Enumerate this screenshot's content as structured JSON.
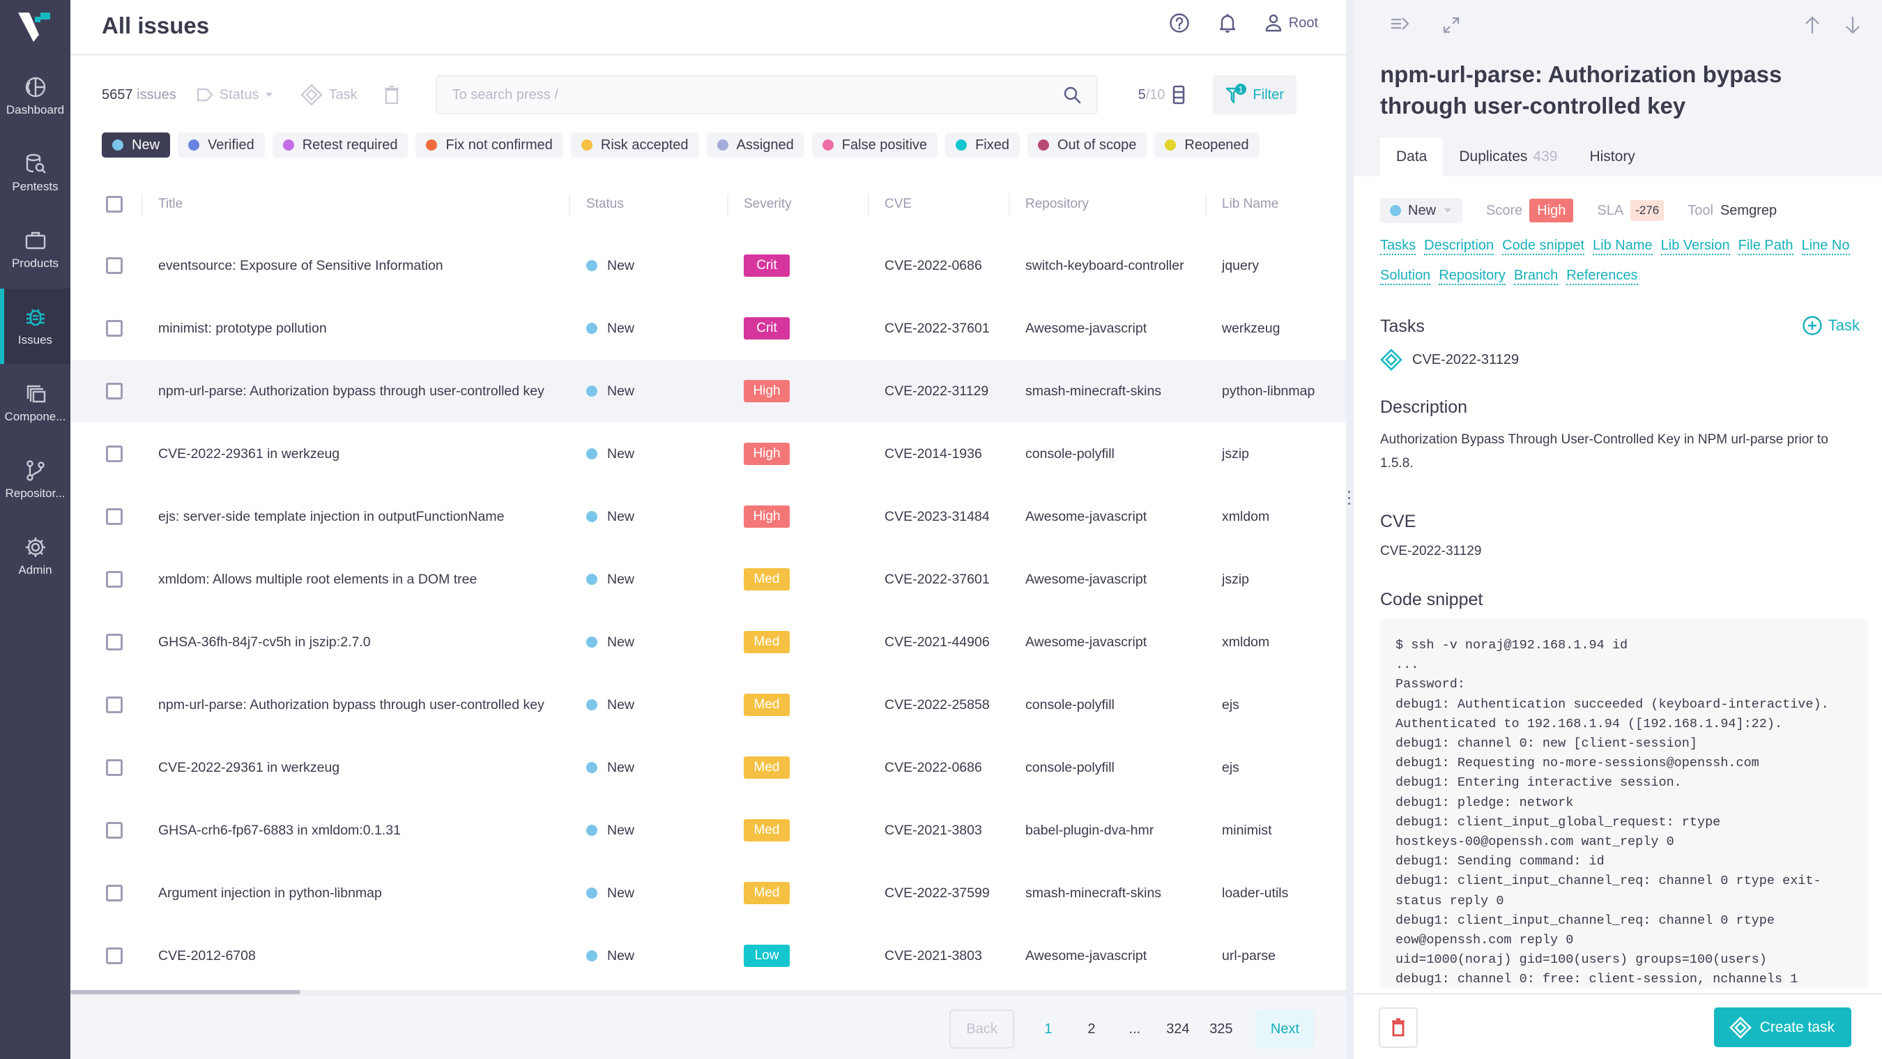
{
  "sidebar": {
    "items": [
      {
        "label": "Dashboard",
        "icon": "dashboard-icon"
      },
      {
        "label": "Pentests",
        "icon": "pentests-icon"
      },
      {
        "label": "Products",
        "icon": "briefcase-icon"
      },
      {
        "label": "Issues",
        "icon": "bug-icon",
        "active": true
      },
      {
        "label": "Compone...",
        "icon": "components-icon"
      },
      {
        "label": "Repositor...",
        "icon": "branch-icon"
      },
      {
        "label": "Admin",
        "icon": "gear-icon"
      }
    ]
  },
  "header": {
    "title": "All issues",
    "user": "Root"
  },
  "toolbar": {
    "count": "5657",
    "count_suffix": "issues",
    "status_label": "Status",
    "task_label": "Task",
    "search_placeholder": "To search press /",
    "columns_shown": "5",
    "columns_total": "/10",
    "filter_label": "Filter",
    "filter_count": "1"
  },
  "status_chips": [
    {
      "label": "New",
      "color": "#7cc5ea",
      "active": true
    },
    {
      "label": "Verified",
      "color": "#6b84e0"
    },
    {
      "label": "Retest required",
      "color": "#c56de6"
    },
    {
      "label": "Fix not confirmed",
      "color": "#ee6d3d"
    },
    {
      "label": "Risk accepted",
      "color": "#f6c142"
    },
    {
      "label": "Assigned",
      "color": "#a2abda"
    },
    {
      "label": "False positive",
      "color": "#ec6ea4"
    },
    {
      "label": "Fixed",
      "color": "#16c6cf"
    },
    {
      "label": "Out of scope",
      "color": "#b84a76"
    },
    {
      "label": "Reopened",
      "color": "#e3d52a"
    }
  ],
  "table": {
    "columns": [
      "Title",
      "Status",
      "Severity",
      "CVE",
      "Repository",
      "Lib Name"
    ],
    "severity_colors": {
      "Crit": "#d6359c",
      "High": "#f47777",
      "Med": "#f6c142",
      "Low": "#16c6cf"
    },
    "rows": [
      {
        "title": "eventsource: Exposure of Sensitive Information",
        "status": "New",
        "severity": "Crit",
        "cve": "CVE-2022-0686",
        "repository": "switch-keyboard-controller",
        "lib": "jquery"
      },
      {
        "title": "minimist: prototype pollution",
        "status": "New",
        "severity": "Crit",
        "cve": "CVE-2022-37601",
        "repository": "Awesome-javascript",
        "lib": "werkzeug"
      },
      {
        "title": "npm-url-parse: Authorization bypass through user-controlled key",
        "status": "New",
        "severity": "High",
        "cve": "CVE-2022-31129",
        "repository": "smash-minecraft-skins",
        "lib": "python-libnmap",
        "selected": true
      },
      {
        "title": "CVE-2022-29361 in werkzeug",
        "status": "New",
        "severity": "High",
        "cve": "CVE-2014-1936",
        "repository": "console-polyfill",
        "lib": "jszip"
      },
      {
        "title": "ejs: server-side template injection in outputFunctionName",
        "status": "New",
        "severity": "High",
        "cve": "CVE-2023-31484",
        "repository": "Awesome-javascript",
        "lib": "xmldom"
      },
      {
        "title": "xmldom: Allows multiple root elements in a DOM tree",
        "status": "New",
        "severity": "Med",
        "cve": "CVE-2022-37601",
        "repository": "Awesome-javascript",
        "lib": "jszip"
      },
      {
        "title": "GHSA-36fh-84j7-cv5h in jszip:2.7.0",
        "status": "New",
        "severity": "Med",
        "cve": "CVE-2021-44906",
        "repository": "Awesome-javascript",
        "lib": "xmldom"
      },
      {
        "title": "npm-url-parse: Authorization bypass through user-controlled key",
        "status": "New",
        "severity": "Med",
        "cve": "CVE-2022-25858",
        "repository": "console-polyfill",
        "lib": "ejs"
      },
      {
        "title": "CVE-2022-29361 in werkzeug",
        "status": "New",
        "severity": "Med",
        "cve": "CVE-2022-0686",
        "repository": "console-polyfill",
        "lib": "ejs"
      },
      {
        "title": "GHSA-crh6-fp67-6883 in xmldom:0.1.31",
        "status": "New",
        "severity": "Med",
        "cve": "CVE-2021-3803",
        "repository": "babel-plugin-dva-hmr",
        "lib": "minimist"
      },
      {
        "title": "Argument injection in python-libnmap",
        "status": "New",
        "severity": "Med",
        "cve": "CVE-2022-37599",
        "repository": "smash-minecraft-skins",
        "lib": "loader-utils"
      },
      {
        "title": "CVE-2012-6708",
        "status": "New",
        "severity": "Low",
        "cve": "CVE-2021-3803",
        "repository": "Awesome-javascript",
        "lib": "url-parse"
      }
    ]
  },
  "pagination": {
    "back": "Back",
    "pages": [
      "1",
      "2",
      "...",
      "324",
      "325"
    ],
    "current": "1",
    "next": "Next"
  },
  "detail": {
    "title": "npm-url-parse: Authorization bypass through user-controlled key",
    "tabs": [
      {
        "label": "Data",
        "active": true
      },
      {
        "label": "Duplicates",
        "count": "439"
      },
      {
        "label": "History"
      }
    ],
    "status": "New",
    "score_label": "Score",
    "score": "High",
    "sla_label": "SLA",
    "sla": "-276",
    "tool_label": "Tool",
    "tool": "Semgrep",
    "anchors": [
      "Tasks",
      "Description",
      "Code snippet",
      "Lib Name",
      "Lib Version",
      "File Path",
      "Line No",
      "Solution",
      "Repository",
      "Branch",
      "References"
    ],
    "tasks_heading": "Tasks",
    "add_task_label": "Task",
    "task_item": "CVE-2022-31129",
    "description_heading": "Description",
    "description": "Authorization Bypass Through User-Controlled Key in NPM url-parse prior to 1.5.8.",
    "cve_heading": "CVE",
    "cve": "CVE-2022-31129",
    "code_heading": "Code snippet",
    "code": "$ ssh -v noraj@192.168.1.94 id\n...\nPassword:\ndebug1: Authentication succeeded (keyboard-interactive).\nAuthenticated to 192.168.1.94 ([192.168.1.94]:22).\ndebug1: channel 0: new [client-session]\ndebug1: Requesting no-more-sessions@openssh.com\ndebug1: Entering interactive session.\ndebug1: pledge: network\ndebug1: client_input_global_request: rtype\nhostkeys-00@openssh.com want_reply 0\ndebug1: Sending command: id\ndebug1: client_input_channel_req: channel 0 rtype exit-\nstatus reply 0\ndebug1: client_input_channel_req: channel 0 rtype\neow@openssh.com reply 0\nuid=1000(noraj) gid=100(users) groups=100(users)\ndebug1: channel 0: free: client-session, nchannels 1",
    "create_task_label": "Create task"
  }
}
